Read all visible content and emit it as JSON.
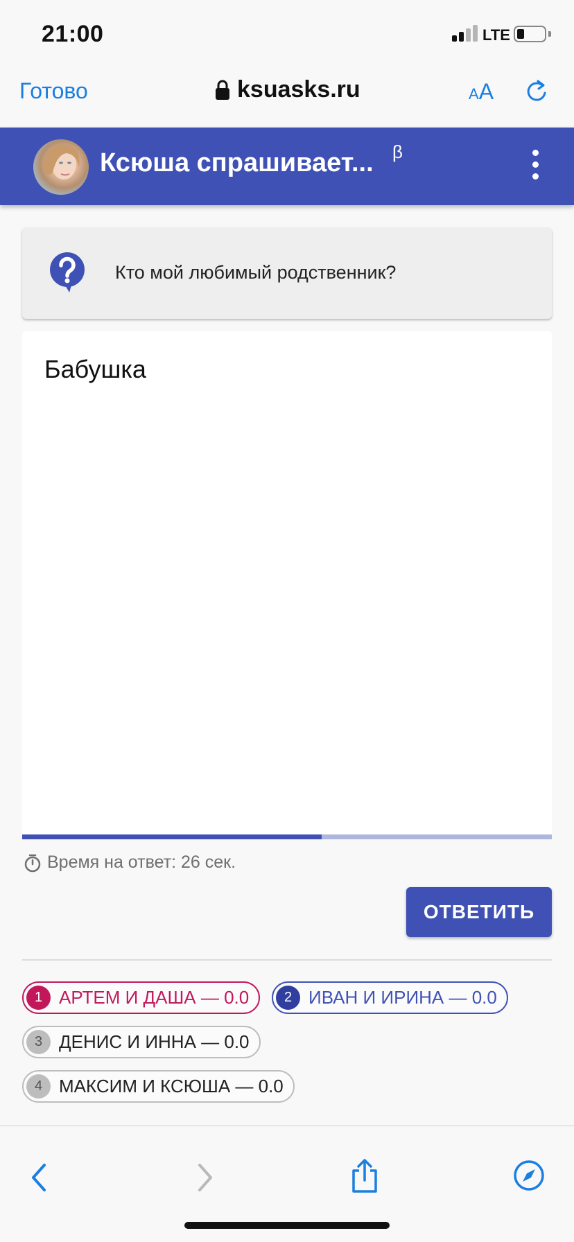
{
  "status_bar": {
    "time": "21:00",
    "network": "LTE"
  },
  "browser": {
    "done_label": "Готово",
    "url": "ksuasks.ru",
    "text_size_small": "A",
    "text_size_large": "A"
  },
  "app": {
    "title": "Ксюша спрашивает...",
    "beta": "β"
  },
  "question": {
    "text": "Кто мой любимый родственник?"
  },
  "answer": {
    "value": "Бабушка"
  },
  "timer": {
    "label": "Время на ответ: 26 сек.",
    "progress_fraction": 0.565
  },
  "submit_label": "ОТВЕТИТЬ",
  "teams": [
    {
      "num": "1",
      "label": "АРТЕМ И ДАША — 0.0",
      "color": "#c2185b"
    },
    {
      "num": "2",
      "label": "ИВАН И ИРИНА — 0.0",
      "color": "#3f51b5"
    },
    {
      "num": "3",
      "label": "ДЕНИС И ИННА — 0.0",
      "color": "#bdbdbd"
    },
    {
      "num": "4",
      "label": "МАКСИМ И КСЮША — 0.0",
      "color": "#bdbdbd"
    }
  ],
  "colors": {
    "primary": "#3f51b5",
    "ios_blue": "#1a7fe0"
  }
}
